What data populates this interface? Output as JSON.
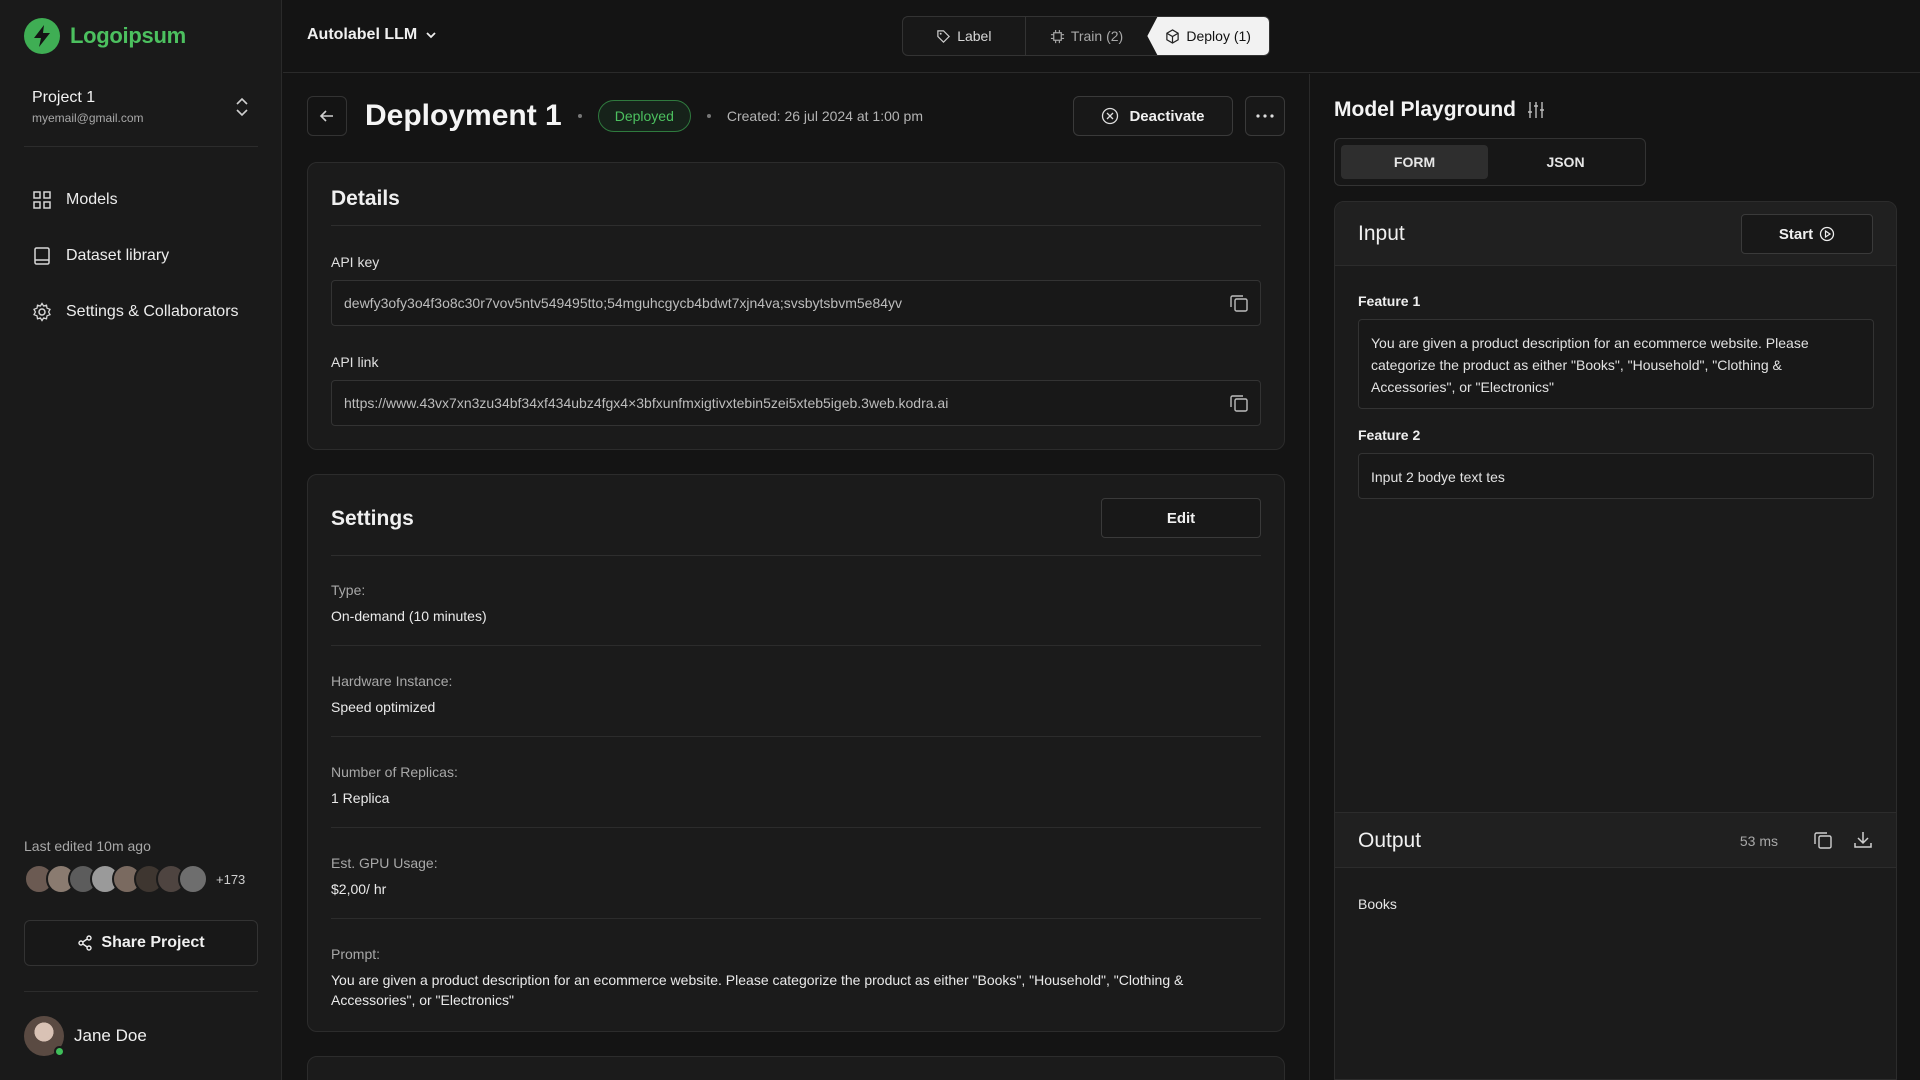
{
  "sidebar": {
    "logo_text": "Logoipsum",
    "project_name": "Project 1",
    "project_email": "myemail@gmail.com",
    "nav": [
      {
        "label": "Models",
        "icon": "grid-icon"
      },
      {
        "label": "Dataset library",
        "icon": "book-icon"
      },
      {
        "label": "Settings & Collaborators",
        "icon": "gear-icon"
      }
    ],
    "last_edited": "Last edited 10m ago",
    "collaborator_count": "+173",
    "share_label": "Share Project",
    "user_name": "Jane Doe"
  },
  "topbar": {
    "app_name": "Autolabel LLM",
    "steps": [
      {
        "label": "Label",
        "icon": "tag-icon"
      },
      {
        "label": "Train (2)",
        "icon": "chip-icon"
      },
      {
        "label": "Deploy (1)",
        "icon": "cube-icon"
      }
    ]
  },
  "main": {
    "title": "Deployment 1",
    "status": "Deployed",
    "created": "Created: 26 jul 2024 at 1:00 pm",
    "deactivate_label": "Deactivate",
    "details": {
      "title": "Details",
      "api_key_label": "API key",
      "api_key_value": "dewfy3ofy3o4f3o8c30r7vov5ntv549495tto;54mguhcgycb4bdwt7xjn4va;svsbytsbvm5e84yv",
      "api_link_label": "API link",
      "api_link_value": "https://www.43vx7xn3zu34bf34xf434ubz4fgx4×3bfxunfmxigtivxtebin5zei5xteb5igeb.3web.kodra.ai"
    },
    "settings": {
      "title": "Settings",
      "edit_label": "Edit",
      "items": [
        {
          "key": "Type:",
          "value": "On-demand (10 minutes)"
        },
        {
          "key": "Hardware Instance:",
          "value": "Speed optimized"
        },
        {
          "key": "Number of Replicas:",
          "value": "1 Replica"
        },
        {
          "key": "Est. GPU Usage:",
          "value": "$2,00/ hr"
        },
        {
          "key": "Prompt:",
          "value": "You are given a product description for an ecommerce website. Please categorize the product as either \"Books\", \"Household\", \"Clothing & Accessories\", or \"Electronics\""
        }
      ]
    }
  },
  "playground": {
    "title": "Model Playground",
    "tabs": [
      "FORM",
      "JSON"
    ],
    "active_tab": "FORM",
    "input_title": "Input",
    "start_label": "Start",
    "feature1_label": "Feature 1",
    "feature1_value": "You are given a product description for an ecommerce website. Please categorize the product as either \"Books\", \"Household\", \"Clothing & Accessories\", or \"Electronics\"",
    "feature2_label": "Feature 2",
    "feature2_value": "Input 2 bodye text tes",
    "output_title": "Output",
    "output_latency": "53 ms",
    "output_value": "Books"
  },
  "colors": {
    "accent_green": "#4cc05f",
    "background": "#141414",
    "panel": "#1b1b1b"
  }
}
